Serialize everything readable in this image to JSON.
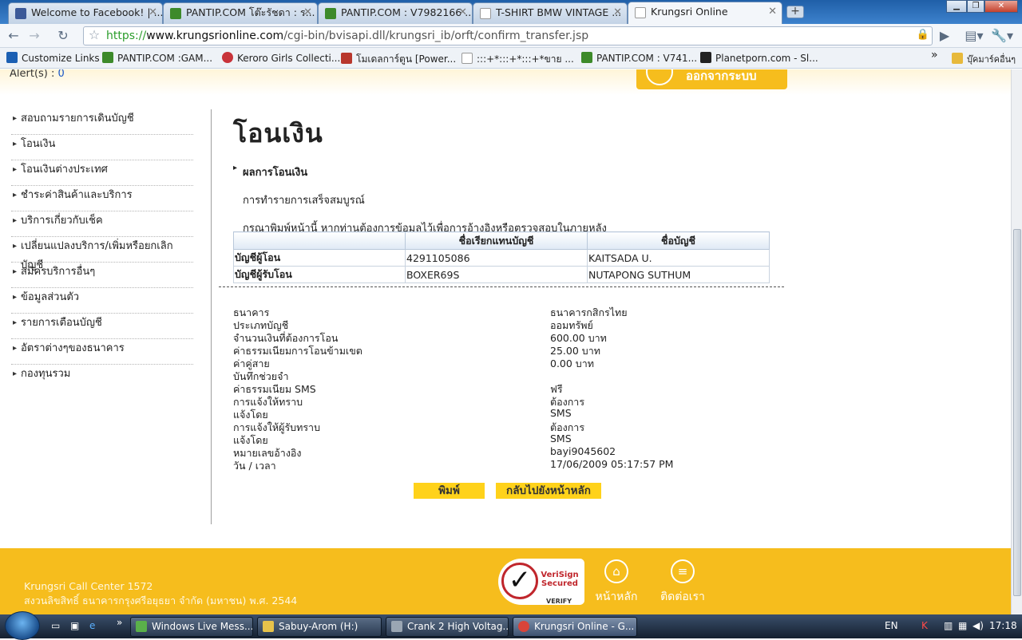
{
  "browser": {
    "tabs": [
      {
        "label": "Welcome to Facebook! | ...",
        "active": false
      },
      {
        "label": "PANTIP.COM โต๊ะรัชดา : ร...",
        "active": false
      },
      {
        "label": "PANTIP.COM : V7982166 ...",
        "active": false
      },
      {
        "label": "T-SHIRT BMW VINTAGE ...",
        "active": false
      },
      {
        "label": "Krungsri Online",
        "active": true
      }
    ],
    "url_scheme": "https://",
    "url_host": "www.krungsrionline.com",
    "url_path": "/cgi-bin/bvisapi.dll/krungsri_ib/orft/confirm_transfer.jsp",
    "bookmarks": [
      "Customize Links",
      "PANTIP.COM :GAM...",
      "Keroro Girls Collecti...",
      "โมเดลการ์ตูน [Power...",
      ":::+*:::+*:::+*ขาย ...",
      "PANTIP.COM : V741...",
      "Planetporn.com - Sl...",
      "บุ๊คมาร์คอื่นๆ"
    ]
  },
  "header": {
    "alerts_label": "Alert(s) :",
    "alerts_count": "0",
    "logout_label": "ออกจากระบบ"
  },
  "sidebar": {
    "items": [
      "สอบถามรายการเดินบัญชี",
      "โอนเงิน",
      "โอนเงินต่างประเทศ",
      "ชำระค่าสินค้าและบริการ",
      "บริการเกี่ยวกับเช็ค",
      "เปลี่ยนแปลงบริการ/เพิ่มหรือยกเลิกบัญชี",
      "สมัครบริการอื่นๆ",
      "ข้อมูลส่วนตัว",
      "รายการเตือนบัญชี",
      "อัตราต่างๆของธนาคาร",
      "กองทุนรวม"
    ]
  },
  "main": {
    "title": "โอนเงิน",
    "section": "ผลการโอนเงิน",
    "success_msg": "การทำรายการเสร็จสมบูรณ์",
    "print_msg": "กรุณาพิมพ์หน้านี้ หากท่านต้องการข้อมูลไว้เพื่อการอ้างอิงหรือตรวจสอบในภายหลัง",
    "table": {
      "headers": [
        "",
        "ชื่อเรียกแทนบัญชี",
        "ชื่อบัญชี"
      ],
      "rows": [
        [
          "บัญชีผู้โอน",
          "4291105086",
          "KAITSADA U."
        ],
        [
          "บัญชีผู้รับโอน",
          "BOXER69S",
          "NUTAPONG SUTHUM"
        ]
      ]
    },
    "details": [
      [
        "ธนาคาร",
        "ธนาคารกสิกรไทย"
      ],
      [
        "ประเภทบัญชี",
        "ออมทรัพย์"
      ],
      [
        "จำนวนเงินที่ต้องการโอน",
        "600.00 บาท"
      ],
      [
        "ค่าธรรมเนียมการโอนข้ามเขต",
        "25.00 บาท"
      ],
      [
        "ค่าคู่สาย",
        "0.00 บาท"
      ],
      [
        "บันทึกช่วยจำ",
        ""
      ],
      [
        "ค่าธรรมเนียม SMS",
        "ฟรี"
      ],
      [
        "การแจ้งให้ทราบ",
        "ต้องการ"
      ],
      [
        "แจ้งโดย",
        "SMS"
      ],
      [
        "การแจ้งให้ผู้รับทราบ",
        "ต้องการ"
      ],
      [
        "แจ้งโดย",
        "SMS"
      ],
      [
        "หมายเลขอ้างอิง",
        "bayi9045602"
      ],
      [
        "วัน / เวลา",
        "17/06/2009 05:17:57 PM"
      ]
    ],
    "print_button": "พิมพ์",
    "home_button": "กลับไปยังหน้าหลัก"
  },
  "footer": {
    "call_center": "Krungsri Call Center 1572",
    "copyright": "สงวนลิขสิทธิ์ ธนาคารกรุงศรีอยุธยา จำกัด (มหาชน) พ.ศ. 2544",
    "verisign_top": "VeriSign",
    "verisign_mid": "Secured",
    "verisign_verify": "VERIFY",
    "home_label": "หน้าหลัก",
    "contact_label": "ติดต่อเรา"
  },
  "taskbar": {
    "tasks": [
      "Windows Live Mess...",
      "Sabuy-Arom (H:)",
      "Crank 2 High Voltag...",
      "Krungsri Online - G..."
    ],
    "lang": "EN",
    "clock": "17:18"
  },
  "colors": {
    "brand_yellow": "#f6bd1d",
    "button_yellow": "#ffd21a",
    "alert_blue": "#1a57c7"
  }
}
